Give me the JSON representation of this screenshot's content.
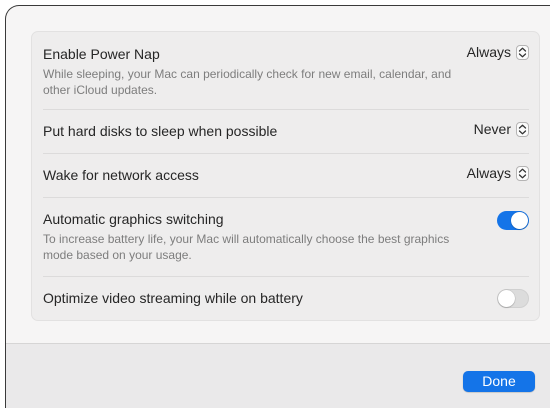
{
  "settings": {
    "power_nap": {
      "title": "Enable Power Nap",
      "description": "While sleeping, your Mac can periodically check for new email, calendar, and other iCloud updates.",
      "value": "Always"
    },
    "hard_disk_sleep": {
      "title": "Put hard disks to sleep when possible",
      "value": "Never"
    },
    "network_wake": {
      "title": "Wake for network access",
      "value": "Always"
    },
    "graphics_switching": {
      "title": "Automatic graphics switching",
      "description": "To increase battery life, your Mac will automatically choose the best graphics mode based on your usage.",
      "enabled": true
    },
    "video_streaming": {
      "title": "Optimize video streaming while on battery",
      "enabled": false
    }
  },
  "footer": {
    "done_label": "Done"
  },
  "colors": {
    "accent": "#1474e8",
    "toggle_off": "#dcdcdc"
  },
  "icons": {
    "popup_indicator": "chevron-up-down-icon"
  }
}
